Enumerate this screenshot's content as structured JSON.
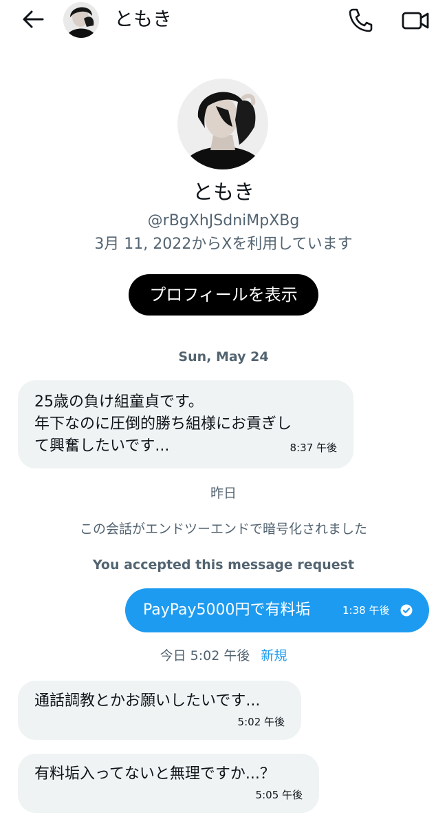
{
  "header": {
    "name": "ともき",
    "back_icon": "arrow-left-icon",
    "call_icon": "phone-icon",
    "video_icon": "video-camera-icon"
  },
  "profile": {
    "name": "ともき",
    "handle": "@rBgXhJSdniMpXBg",
    "joined": "3月 11, 2022からXを利用しています",
    "view_profile_label": "プロフィールを表示"
  },
  "timeline": {
    "date_separator": "Sun, May 24",
    "yesterday_separator": "昨日",
    "encryption_note": "この会話がエンドツーエンドで暗号化されました",
    "accepted_note": "You accepted this message request",
    "today_label": "今日 5:02 午後",
    "new_label": "新規"
  },
  "messages": [
    {
      "direction": "incoming",
      "text": "25歳の負け組童貞です。\n年下なのに圧倒的勝ち組様にお貢ぎし\nて興奮したいです...",
      "time": "8:37 午後"
    },
    {
      "direction": "outgoing",
      "text": "PayPay5000円で有料垢",
      "time": "1:38 午後",
      "status_icon": "check-circle-icon"
    },
    {
      "direction": "incoming",
      "text": "通話調教とかお願いしたいです...",
      "time": "5:02 午後"
    },
    {
      "direction": "incoming",
      "text": "有料垢入ってないと無理ですか...？",
      "time": "5:05 午後"
    }
  ],
  "colors": {
    "accent": "#1d9bf0",
    "incoming_bubble": "#eff3f4",
    "secondary_text": "#536471",
    "primary_text": "#0f1419",
    "button_bg": "#000000"
  }
}
